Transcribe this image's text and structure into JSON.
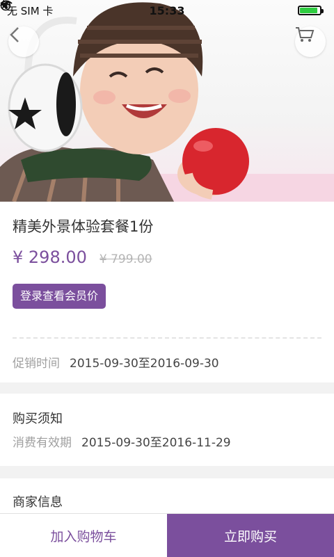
{
  "status_bar": {
    "carrier": "无 SIM 卡",
    "time": "15:33"
  },
  "product": {
    "title": "精美外景体验套餐1份",
    "price": "¥ 298.00",
    "original_price": "¥ 799.00",
    "member_price_button": "登录查看会员价",
    "promo_label": "促销时间",
    "promo_range": "2015-09-30至2016-09-30"
  },
  "notice": {
    "title": "购买须知",
    "validity_label": "消费有效期",
    "validity_range": "2015-09-30至2016-11-29"
  },
  "merchant": {
    "title": "商家信息"
  },
  "bottom_bar": {
    "add_to_cart": "加入购物车",
    "buy_now": "立即购买"
  },
  "icons": {
    "back": "chevron-left-icon",
    "cart": "shopping-cart-icon",
    "wifi": "wifi-icon",
    "orientation_lock": "orientation-lock-icon",
    "location": "location-arrow-icon",
    "battery": "battery-icon",
    "charging": "charging-bolt-icon"
  },
  "colors": {
    "accent": "#7b4f9d",
    "battery": "#2ecc40"
  }
}
